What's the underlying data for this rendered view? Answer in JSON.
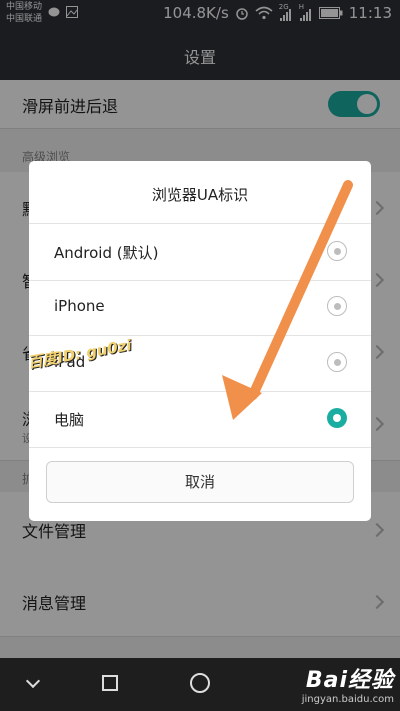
{
  "statusbar": {
    "carrier1": "中国移动",
    "carrier2": "中国联通",
    "speed": "104.8K/s",
    "net1": "2G",
    "net2": "H",
    "time": "11:13"
  },
  "header": {
    "title": "设置"
  },
  "settings": {
    "swipe_nav": {
      "label": "滑屏前进后退",
      "enabled": true
    },
    "section_advanced": "高级浏览",
    "row_partial_1": "默",
    "row_partial_2": "智",
    "row_partial_3": "省",
    "row_partial_4": "浏",
    "row_partial_4_sub": "设",
    "section_partial": "扩",
    "file_manage": "文件管理",
    "message_manage": "消息管理"
  },
  "dialog": {
    "title": "浏览器UA标识",
    "options": [
      {
        "label": "Android (默认)",
        "selected": false
      },
      {
        "label": "iPhone",
        "selected": false
      },
      {
        "label": "iPad",
        "selected": false
      },
      {
        "label": "电脑",
        "selected": true
      }
    ],
    "cancel_label": "取消"
  },
  "watermark": "百度ID: gu0zi",
  "brand": {
    "logo": "Bai经验",
    "url": "jingyan.baidu.com"
  },
  "colors": {
    "accent": "#1aaea2",
    "arrow": "#f0904a",
    "bar": "#2e3137"
  }
}
